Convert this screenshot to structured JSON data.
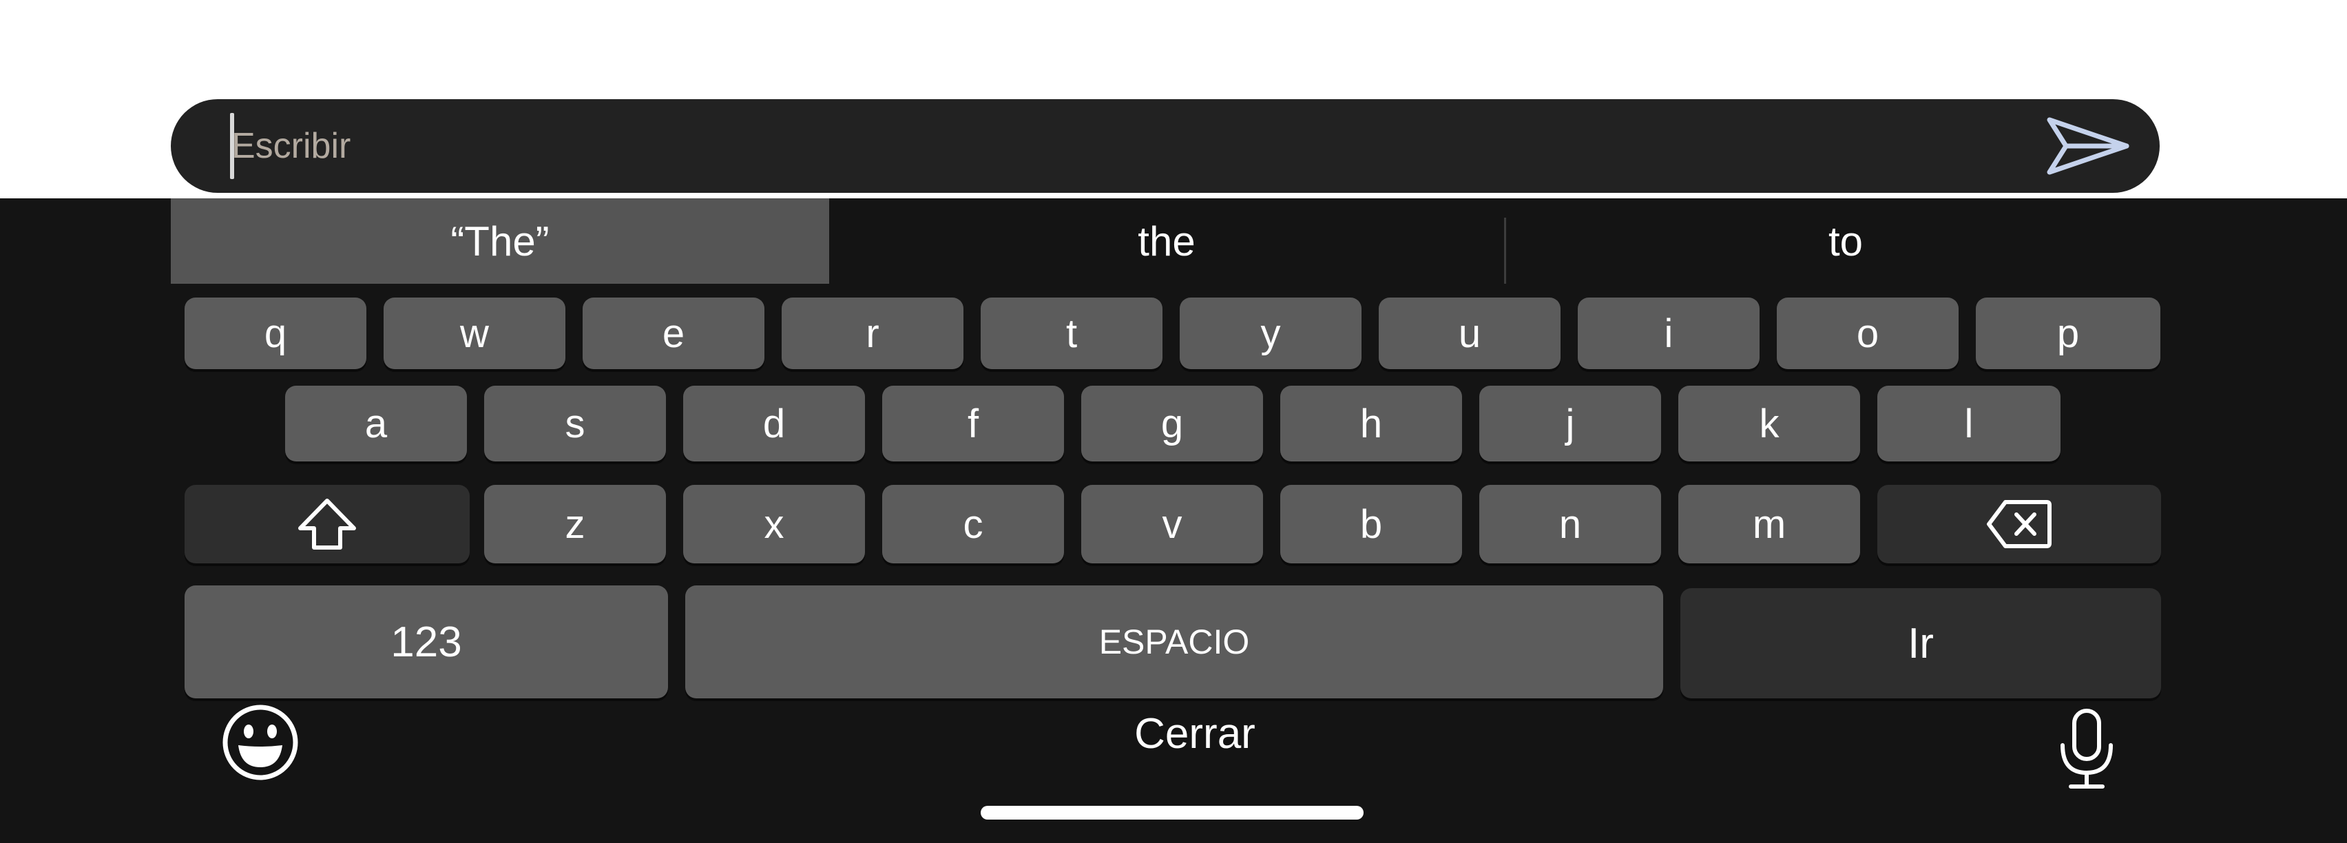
{
  "input": {
    "placeholder": "Escribir",
    "value": ""
  },
  "suggestions": [
    "“The”",
    "the",
    "to"
  ],
  "keys": {
    "row1": [
      "q",
      "w",
      "e",
      "r",
      "t",
      "y",
      "u",
      "i",
      "o",
      "p"
    ],
    "row2": [
      "a",
      "s",
      "d",
      "f",
      "g",
      "h",
      "j",
      "k",
      "l"
    ],
    "row3": [
      "z",
      "x",
      "c",
      "v",
      "b",
      "n",
      "m"
    ],
    "numbers_label": "123",
    "space_label": "ESPACIO",
    "go_label": "Ir"
  },
  "bottom_bar": {
    "close_label": "Cerrar"
  },
  "icons": {
    "send": "send-icon",
    "shift": "shift-icon",
    "backspace": "backspace-icon",
    "emoji": "emoji-icon",
    "mic": "microphone-icon"
  },
  "colors": {
    "input_bg": "#222222",
    "keyboard_bg": "#141414",
    "key_bg": "#5c5c5c",
    "modifier_key_bg": "#2e2e2e",
    "suggestion_selected_bg": "#555555",
    "send_icon": "#c5d2ec"
  }
}
